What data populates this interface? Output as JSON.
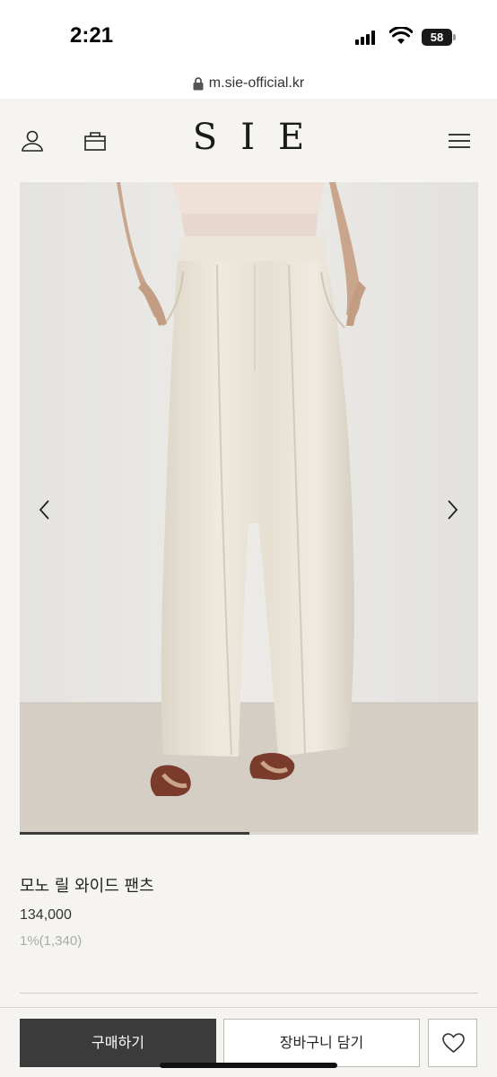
{
  "status_bar": {
    "time": "2:21",
    "battery": "58"
  },
  "browser": {
    "url": "m.sie-official.kr"
  },
  "header": {
    "logo": "SIE",
    "icons": [
      "user-icon",
      "shopping-bag-icon",
      "menu-icon"
    ]
  },
  "product": {
    "name": "모노 릴 와이드 팬츠",
    "price": "134,000",
    "points": "1%(1,340)",
    "image_progress": 0.5
  },
  "actions": {
    "buy_label": "구매하기",
    "cart_label": "장바구니 담기",
    "wishlist_icon": "heart-icon"
  },
  "colors": {
    "background": "#f5f4f0",
    "buy_button": "#3b3b3b",
    "pants": "#ece6da"
  }
}
